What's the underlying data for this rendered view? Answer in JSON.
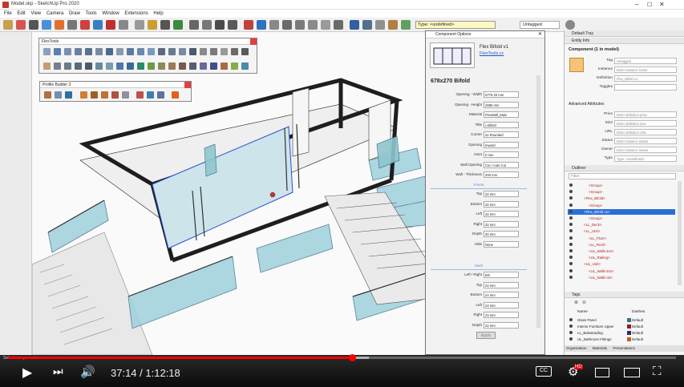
{
  "window": {
    "title": "Model.skp - SketchUp Pro 2020"
  },
  "menu": [
    "File",
    "Edit",
    "View",
    "Camera",
    "Draw",
    "Tools",
    "Window",
    "Extensions",
    "Help"
  ],
  "toolbar": {
    "type_field": "Type: <undefined>",
    "tag_select": "Untagged"
  },
  "panels": {
    "flextools_title": "FlexTools",
    "profile_builder_title": "Profile Builder 3"
  },
  "component_options": {
    "title": "Component Options",
    "component_name": "Flex Bifold v1",
    "component_link": "FlexTools.cc",
    "heading": "678x270 Bifold",
    "rows": [
      {
        "label": "Opening - Width",
        "value": "6775.33 mm"
      },
      {
        "label": "Opening - Height",
        "value": "2695 mm"
      },
      {
        "label": "Material",
        "value": "FlexWall_Main"
      },
      {
        "label": "Title",
        "value": "c.Bifold"
      },
      {
        "label": "Corner",
        "value": "2x Rounded"
      },
      {
        "label": "Opening",
        "value": "Inward"
      },
      {
        "label": "Inset",
        "value": "0 mm"
      },
      {
        "label": "Wall Opening",
        "value": "Cut / Auto Cut"
      },
      {
        "label": "Wall - Thickness",
        "value": "200 mm"
      }
    ],
    "section1": "Frame",
    "rows2": [
      {
        "label": "Top",
        "value": "32 mm"
      },
      {
        "label": "Bottom",
        "value": "32 mm"
      },
      {
        "label": "Left",
        "value": "32 mm"
      },
      {
        "label": "Right",
        "value": "32 mm"
      },
      {
        "label": "Depth",
        "value": "30 mm"
      },
      {
        "label": "Hide",
        "value": "None"
      }
    ],
    "section2": "Sash",
    "rows3": [
      {
        "label": "Left / Right",
        "value": "6/6"
      },
      {
        "label": "Top",
        "value": "24 mm"
      },
      {
        "label": "Bottom",
        "value": "24 mm"
      },
      {
        "label": "Left",
        "value": "24 mm"
      },
      {
        "label": "Right",
        "value": "24 mm"
      },
      {
        "label": "Depth",
        "value": "22 mm"
      }
    ],
    "apply_label": "Apply"
  },
  "entity_info": {
    "header": "Entity Info",
    "title": "Component (1 in model)",
    "rows": [
      {
        "label": "Tag",
        "value": "Untagged"
      },
      {
        "label": "Instance",
        "value": "Enter instance name"
      },
      {
        "label": "Definition",
        "value": "Flex_Bifold v1"
      },
      {
        "label": "Toggles",
        "value": ""
      }
    ],
    "advanced": "Advanced Attributes",
    "adv_rows": [
      {
        "label": "Price",
        "value": "Enter definition price"
      },
      {
        "label": "Size",
        "value": "Enter definition size"
      },
      {
        "label": "URL",
        "value": "Enter definition URL"
      },
      {
        "label": "Status",
        "value": "Enter instance status"
      },
      {
        "label": "Owner",
        "value": "Enter instance owner"
      },
      {
        "label": "Type",
        "value": "Type: <undefined>"
      }
    ]
  },
  "outliner": {
    "header": "Outliner",
    "filter": "Filter",
    "rows": [
      {
        "name": "<Group>",
        "indent": 3,
        "selected": false
      },
      {
        "name": "<Group>",
        "indent": 3,
        "selected": false
      },
      {
        "name": "<Flex_Bifold>",
        "indent": 2,
        "selected": false
      },
      {
        "name": "<Group>",
        "indent": 3,
        "selected": false
      },
      {
        "name": "<Flex_Bifold v1>",
        "indent": 2,
        "selected": true
      },
      {
        "name": "<Group>",
        "indent": 3,
        "selected": false
      },
      {
        "name": "<LL_Deck>",
        "indent": 2,
        "selected": false
      },
      {
        "name": "<LL_Unit>",
        "indent": 2,
        "selected": false
      },
      {
        "name": "<LL_Floor>",
        "indent": 3,
        "selected": false
      },
      {
        "name": "<LL_Roof>",
        "indent": 3,
        "selected": false
      },
      {
        "name": "<UL_Walls Ext>",
        "indent": 3,
        "selected": false
      },
      {
        "name": "<UL_Railing>",
        "indent": 3,
        "selected": false
      },
      {
        "name": "<UL_Unit>",
        "indent": 2,
        "selected": false
      },
      {
        "name": "<UL_Walls Ext>",
        "indent": 3,
        "selected": false
      },
      {
        "name": "<UL_Walls Int>",
        "indent": 3,
        "selected": false
      }
    ]
  },
  "tags": {
    "header": "Tags",
    "col_name": "Name",
    "col_dashes": "Dashes",
    "rows": [
      {
        "name": "Glass Panel",
        "color": "#3c6e8a",
        "dash": "Default"
      },
      {
        "name": "Interior Furniture Upper",
        "color": "#8a2020",
        "dash": "Default"
      },
      {
        "name": "LL_Balustrading",
        "color": "#2a2a6a",
        "dash": "Default"
      },
      {
        "name": "UL_Bathroom Fittings",
        "color": "#c06020",
        "dash": "Default"
      }
    ],
    "tabs": [
      "Organisation",
      "Materials",
      "Presentations"
    ]
  },
  "status": {
    "text": "Select components"
  },
  "video": {
    "time_current": "37:14",
    "time_total": "1:12:18",
    "progress": 0.515,
    "buffered": 0.54,
    "hd_badge": "HD"
  }
}
